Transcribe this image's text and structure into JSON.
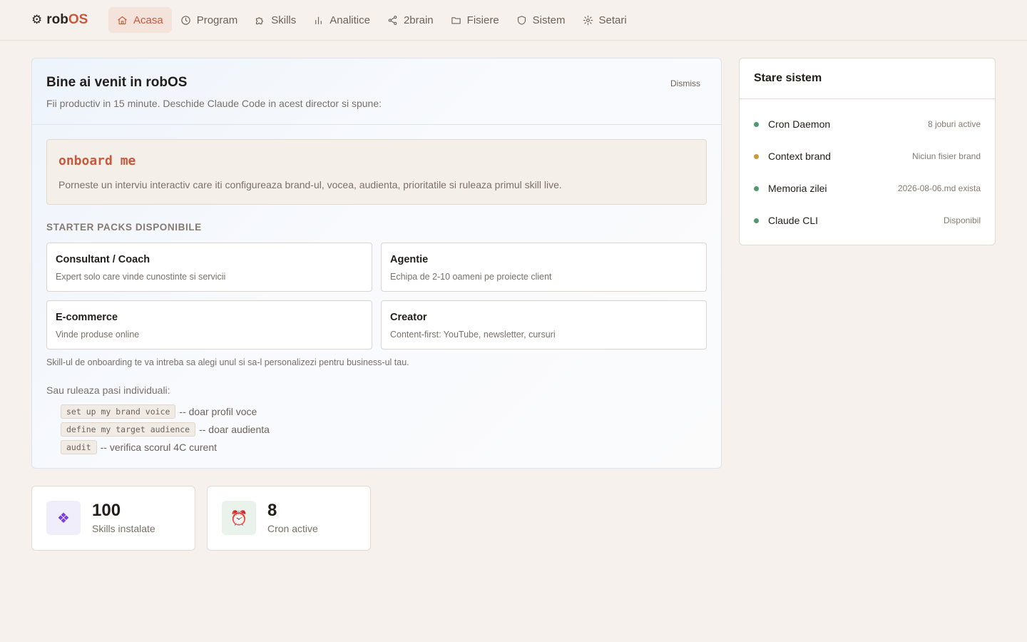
{
  "app": {
    "name_prefix": "rob",
    "name_accent": "OS",
    "logo_icon": "gear-icon"
  },
  "nav": {
    "items": [
      {
        "label": "Acasa",
        "icon": "home-icon",
        "active": true
      },
      {
        "label": "Program",
        "icon": "clock-icon"
      },
      {
        "label": "Skills",
        "icon": "puzzle-icon"
      },
      {
        "label": "Analitice",
        "icon": "bar-chart-icon"
      },
      {
        "label": "2brain",
        "icon": "share-icon"
      },
      {
        "label": "Fisiere",
        "icon": "folder-icon"
      },
      {
        "label": "Sistem",
        "icon": "shield-icon"
      },
      {
        "label": "Setari",
        "icon": "gear-icon"
      }
    ]
  },
  "welcome": {
    "title": "Bine ai venit in robOS",
    "subtitle": "Fii productiv in 15 minute. Deschide Claude Code in acest director si spune:",
    "dismiss": "Dismiss",
    "command": "onboard me",
    "command_desc": "Porneste un interviu interactiv care iti configureaza brand-ul, vocea, audienta, prioritatile si ruleaza primul skill live.",
    "packs_title": "STARTER PACKS DISPONIBILE",
    "packs": [
      {
        "name": "Consultant / Coach",
        "desc": "Expert solo care vinde cunostinte si servicii"
      },
      {
        "name": "Agentie",
        "desc": "Echipa de 2-10 oameni pe proiecte client"
      },
      {
        "name": "E-commerce",
        "desc": "Vinde produse online"
      },
      {
        "name": "Creator",
        "desc": "Content-first: YouTube, newsletter, cursuri"
      }
    ],
    "packs_note": "Skill-ul de onboarding te va intreba sa alegi unul si sa-l personalizezi pentru business-ul tau.",
    "steps_title": "Sau ruleaza pasi individuali:",
    "steps": [
      {
        "code": "set up my brand voice",
        "desc": "-- doar profil voce"
      },
      {
        "code": "define my target audience",
        "desc": "-- doar audienta"
      },
      {
        "code": "audit",
        "desc": "-- verifica scorul 4C curent"
      }
    ]
  },
  "status": {
    "title": "Stare sistem",
    "rows": [
      {
        "label": "Cron Daemon",
        "value": "8 joburi active",
        "color": "#4e9a6b"
      },
      {
        "label": "Context brand",
        "value": "Niciun fisier brand",
        "color": "#c99a3a"
      },
      {
        "label": "Memoria zilei",
        "value": "2026-08-06.md exista",
        "color": "#4e9a6b"
      },
      {
        "label": "Claude CLI",
        "value": "Disponibil",
        "color": "#4e9a6b"
      }
    ]
  },
  "stats": [
    {
      "value": "100",
      "label": "Skills instalate",
      "icon": "❖",
      "icon_name": "skills-icon",
      "icon_bg": "#f1eefc",
      "icon_color": "#7b3fe0"
    },
    {
      "value": "8",
      "label": "Cron active",
      "icon": "⏰",
      "icon_name": "alarm-clock-icon",
      "icon_bg": "#eaf2ec",
      "icon_color": "#c9593a"
    }
  ]
}
